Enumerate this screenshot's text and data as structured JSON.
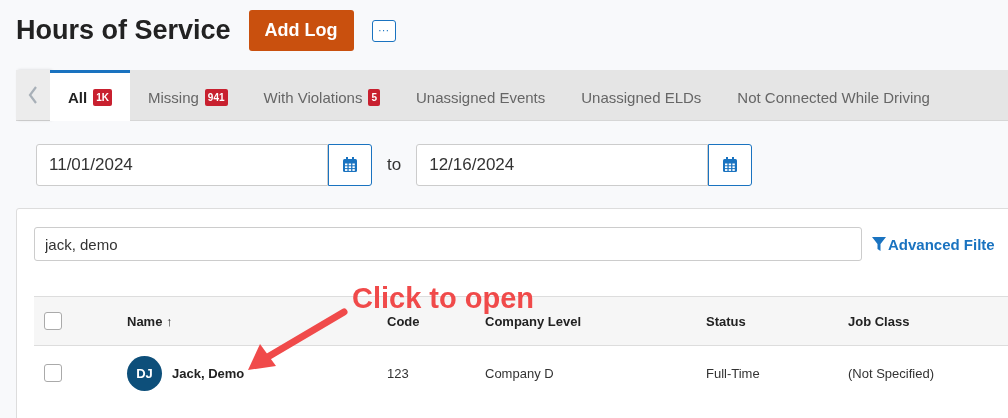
{
  "header": {
    "title": "Hours of Service",
    "add_button": "Add Log",
    "more_button": "···"
  },
  "tabs": [
    {
      "label": "All",
      "badge": "1K",
      "selected": true
    },
    {
      "label": "Missing",
      "badge": "941",
      "selected": false
    },
    {
      "label": "With Violations",
      "badge": "5",
      "selected": false
    },
    {
      "label": "Unassigned Events",
      "selected": false
    },
    {
      "label": "Unassigned ELDs",
      "selected": false
    },
    {
      "label": "Not Connected While Driving",
      "selected": false
    }
  ],
  "date_range": {
    "from": "11/01/2024",
    "separator": "to",
    "to": "12/16/2024"
  },
  "search": {
    "value": "jack, demo"
  },
  "advanced_filter": "Advanced Filte",
  "table": {
    "columns": [
      {
        "label": "Name",
        "sort": "↑"
      },
      {
        "label": "Code"
      },
      {
        "label": "Company Level"
      },
      {
        "label": "Status"
      },
      {
        "label": "Job Class"
      }
    ],
    "header_checked": false,
    "rows": [
      {
        "checked": false,
        "initials": "DJ",
        "name": "Jack, Demo",
        "code": "123",
        "company_level": "Company D",
        "status": "Full-Time",
        "job_class": "(Not Specified)"
      }
    ]
  },
  "annotation": {
    "text": "Click to open"
  }
}
